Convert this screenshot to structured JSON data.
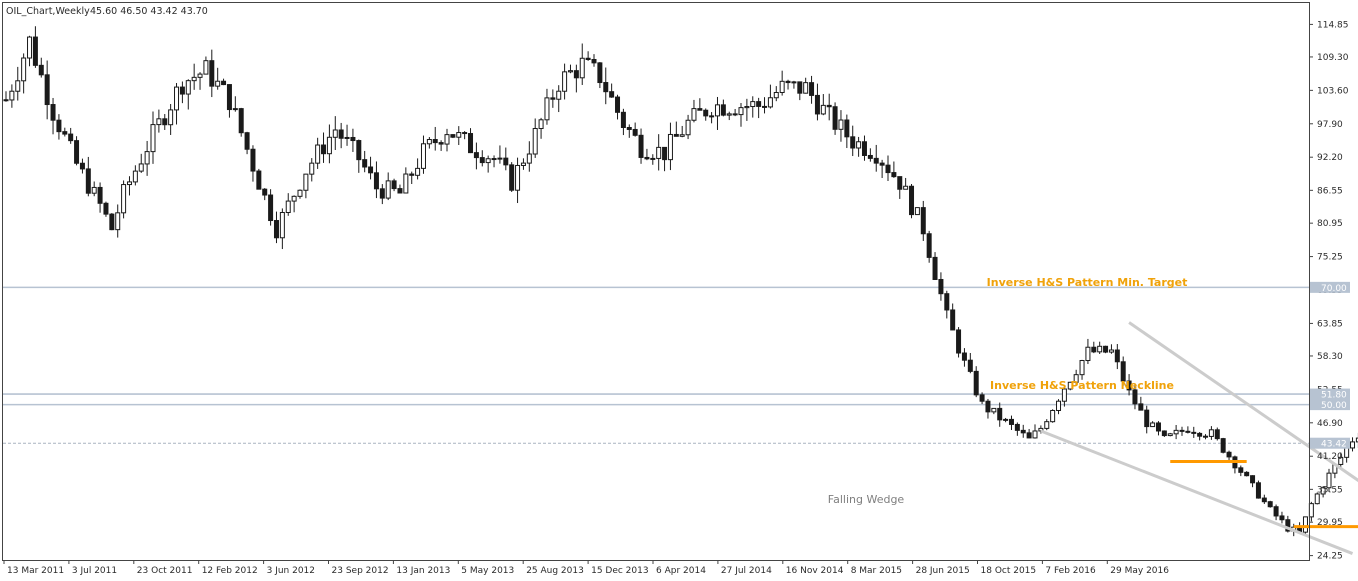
{
  "header": {
    "symbol": "OIL_Chart,Weekly",
    "ohlc": "45.60 46.50 43.42 43.70"
  },
  "colors": {
    "candle": "#1a1a1a",
    "axis": "#444444",
    "level_line": "#b7c3d2",
    "price_tag_bg": "#b7c3d2",
    "current_line": "#a9b4c0",
    "wedge": "#cccccc",
    "support": "#ff9900",
    "annotation": "#f0a20a",
    "wedge_label": "#7f7f7f"
  },
  "chart_data": {
    "type": "candlestick",
    "timeframe": "Weekly",
    "ylim": [
      23.5,
      118.5
    ],
    "yticks": [
      "114.85",
      "109.30",
      "103.60",
      "97.90",
      "92.20",
      "86.55",
      "80.95",
      "75.25",
      "69.55",
      "63.85",
      "58.30",
      "52.55",
      "46.90",
      "41.20",
      "35.55",
      "29.95",
      "24.25"
    ],
    "xticks": [
      "13 Mar 2011",
      "3 Jul 2011",
      "23 Oct 2011",
      "12 Feb 2012",
      "3 Jun 2012",
      "23 Sep 2012",
      "13 Jan 2013",
      "5 May 2013",
      "25 Aug 2013",
      "15 Dec 2013",
      "6 Apr 2014",
      "27 Jul 2014",
      "16 Nov 2014",
      "8 Mar 2015",
      "28 Jun 2015",
      "18 Oct 2015",
      "7 Feb 2016",
      "29 May 2016"
    ],
    "price_path": [
      [
        0,
        102
      ],
      [
        4,
        112
      ],
      [
        8,
        100
      ],
      [
        12,
        91
      ],
      [
        16,
        84
      ],
      [
        18,
        80
      ],
      [
        20,
        86
      ],
      [
        25,
        96
      ],
      [
        30,
        105
      ],
      [
        34,
        107
      ],
      [
        38,
        102
      ],
      [
        43,
        88
      ],
      [
        46,
        80
      ],
      [
        51,
        90
      ],
      [
        56,
        97
      ],
      [
        60,
        92
      ],
      [
        63,
        87
      ],
      [
        67,
        86
      ],
      [
        71,
        93
      ],
      [
        75,
        97
      ],
      [
        79,
        94
      ],
      [
        83,
        92
      ],
      [
        86,
        88
      ],
      [
        90,
        96
      ],
      [
        94,
        105
      ],
      [
        98,
        108
      ],
      [
        101,
        106
      ],
      [
        105,
        98
      ],
      [
        108,
        94
      ],
      [
        112,
        93
      ],
      [
        116,
        98
      ],
      [
        120,
        101
      ],
      [
        124,
        101
      ],
      [
        128,
        101
      ],
      [
        132,
        104
      ],
      [
        136,
        104
      ],
      [
        140,
        99
      ],
      [
        144,
        95
      ],
      [
        148,
        93
      ],
      [
        152,
        88
      ],
      [
        156,
        80
      ],
      [
        160,
        65
      ],
      [
        163,
        57
      ],
      [
        166,
        50
      ],
      [
        170,
        47
      ],
      [
        174,
        44
      ],
      [
        176,
        46
      ],
      [
        180,
        53
      ],
      [
        184,
        59
      ],
      [
        188,
        59
      ],
      [
        191,
        52
      ],
      [
        194,
        47
      ],
      [
        197,
        44
      ],
      [
        201,
        46
      ],
      [
        205,
        45
      ],
      [
        209,
        40
      ],
      [
        212,
        36
      ],
      [
        215,
        32
      ],
      [
        218,
        29
      ],
      [
        220,
        28
      ],
      [
        222,
        33
      ],
      [
        225,
        38
      ],
      [
        229,
        44
      ],
      [
        233,
        48
      ],
      [
        235,
        50
      ],
      [
        237,
        51
      ],
      [
        239,
        50
      ],
      [
        241,
        47
      ],
      [
        243,
        44
      ],
      [
        245,
        47
      ],
      [
        247,
        48
      ],
      [
        249,
        44
      ]
    ],
    "levels": [
      {
        "value": 70.0,
        "label": "70.00"
      },
      {
        "value": 51.8,
        "label": "51.80"
      },
      {
        "value": 50.0,
        "label": "50.00"
      },
      {
        "value": 43.42,
        "label": "43.42",
        "current": true
      }
    ],
    "annotations": {
      "target": "Inverse H&S Pattern Min. Target",
      "neckline": "Inverse H&S Pattern Neckline",
      "wedge": "Falling Wedge"
    },
    "wedge_lines": [
      {
        "from": [
          191,
          64.0
        ],
        "to": [
          246,
          26.0
        ]
      },
      {
        "from": [
          176,
          45.5
        ],
        "to": [
          229,
          24.6
        ]
      }
    ],
    "support_segments": [
      {
        "from": 198,
        "to": 211,
        "value": 40.3
      },
      {
        "from": 219,
        "to": 232,
        "value": 29.2
      },
      {
        "from": 238,
        "to": 252,
        "value": 40.8
      }
    ]
  }
}
